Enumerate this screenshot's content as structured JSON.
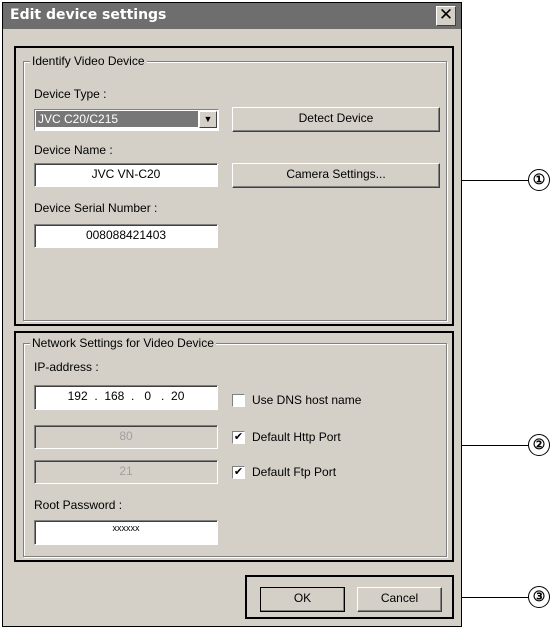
{
  "dialog": {
    "title": "Edit device settings",
    "close_label": "✕"
  },
  "identify": {
    "legend": "Identify Video Device",
    "device_type_label": "Device Type :",
    "device_type_value": "JVC C20/C215",
    "detect_button": "Detect Device",
    "device_name_label": "Device Name :",
    "device_name_value": "JVC VN-C20",
    "camera_settings_button": "Camera Settings...",
    "serial_label": "Device Serial Number :",
    "serial_value": "008088421403"
  },
  "network": {
    "legend": "Network Settings for Video Device",
    "ip_label": "IP-address :",
    "ip_value": "192  .  168  .   0   .  20",
    "dns_label": "Use DNS host name",
    "dns_checked": false,
    "http_port_value": "80",
    "http_label": "Default Http Port",
    "http_checked": true,
    "ftp_port_value": "21",
    "ftp_label": "Default Ftp Port",
    "ftp_checked": true,
    "root_password_label": "Root Password :",
    "root_password_value": "xxxxxx"
  },
  "footer": {
    "ok_label": "OK",
    "cancel_label": "Cancel"
  },
  "callouts": [
    "①",
    "②",
    "③"
  ],
  "check_glyph": "✔"
}
